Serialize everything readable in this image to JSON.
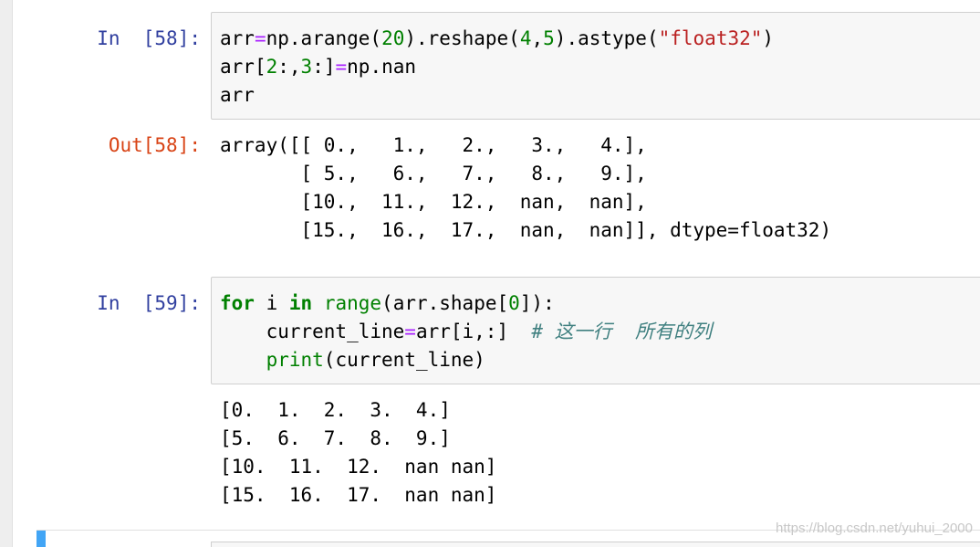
{
  "cells": [
    {
      "in_prompt": "In  [58]:",
      "code": [
        [
          {
            "t": "arr"
          },
          {
            "t": "=",
            "c": "op"
          },
          {
            "t": "np"
          },
          {
            "t": "."
          },
          {
            "t": "arange"
          },
          {
            "t": "("
          },
          {
            "t": "20",
            "c": "num"
          },
          {
            "t": ")."
          },
          {
            "t": "reshape"
          },
          {
            "t": "("
          },
          {
            "t": "4",
            "c": "num"
          },
          {
            "t": ","
          },
          {
            "t": "5",
            "c": "num"
          },
          {
            "t": ")."
          },
          {
            "t": "astype"
          },
          {
            "t": "("
          },
          {
            "t": "\"float32\"",
            "c": "str"
          },
          {
            "t": ")"
          }
        ],
        [
          {
            "t": "arr"
          },
          {
            "t": "["
          },
          {
            "t": "2",
            "c": "num"
          },
          {
            "t": ":,"
          },
          {
            "t": "3",
            "c": "num"
          },
          {
            "t": ":]"
          },
          {
            "t": "=",
            "c": "op"
          },
          {
            "t": "np.nan"
          }
        ],
        [
          {
            "t": "arr"
          }
        ]
      ],
      "out_prompt": "Out[58]:",
      "output": [
        "array([[ 0.,   1.,   2.,   3.,   4.],",
        "       [ 5.,   6.,   7.,   8.,   9.],",
        "       [10.,  11.,  12.,  nan,  nan],",
        "       [15.,  16.,  17.,  nan,  nan]], dtype=float32)"
      ]
    },
    {
      "in_prompt": "In  [59]:",
      "code": [
        [
          {
            "t": "for",
            "c": "kw"
          },
          {
            "t": " i "
          },
          {
            "t": "in",
            "c": "kw"
          },
          {
            "t": " "
          },
          {
            "t": "range",
            "c": "bi"
          },
          {
            "t": "(arr.shape["
          },
          {
            "t": "0",
            "c": "num"
          },
          {
            "t": "]):"
          }
        ],
        [
          {
            "t": "    current_line"
          },
          {
            "t": "=",
            "c": "op"
          },
          {
            "t": "arr[i,:]  "
          },
          {
            "t": "# 这一行  所有的列",
            "c": "cm"
          }
        ],
        [
          {
            "t": "    "
          },
          {
            "t": "print",
            "c": "bi"
          },
          {
            "t": "(current_line)"
          }
        ]
      ],
      "output": [
        "[0.  1.  2.  3.  4.]",
        "[5.  6.  7.  8.  9.]",
        "[10.  11.  12.  nan nan]",
        "[15.  16.  17.  nan nan]"
      ]
    }
  ],
  "watermark": "https://blog.csdn.net/yuhui_2000",
  "colors": {
    "in_prompt": "#303f9f",
    "out_prompt": "#d84315",
    "keyword": "#008000",
    "string": "#ba2121",
    "comment": "#408080",
    "operator": "#aa22ff",
    "cell_selected_bar": "#42a5f5"
  }
}
